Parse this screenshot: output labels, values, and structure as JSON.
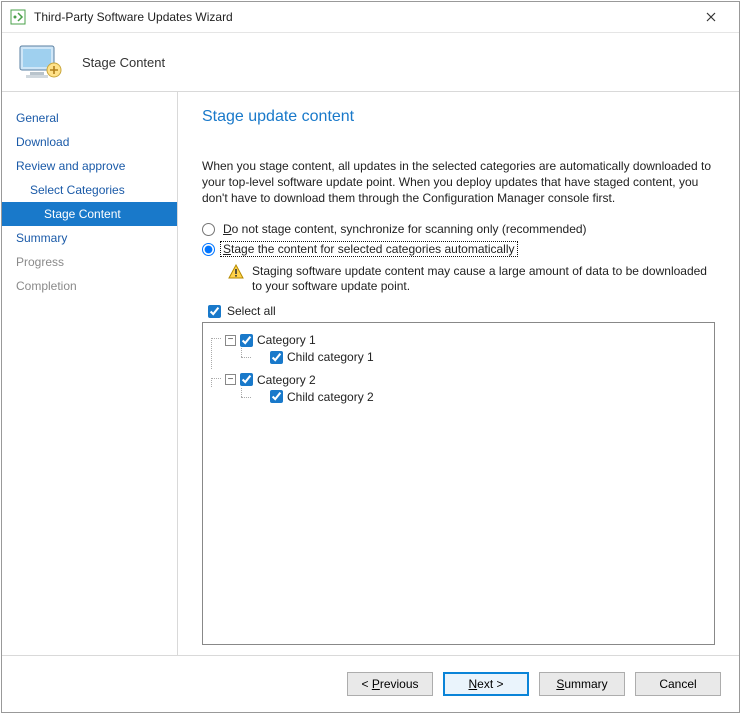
{
  "window": {
    "title": "Third-Party Software Updates Wizard"
  },
  "header": {
    "page_label": "Stage Content"
  },
  "sidebar": {
    "items": [
      {
        "label": "General",
        "level": 0,
        "state": "link"
      },
      {
        "label": "Download",
        "level": 0,
        "state": "link"
      },
      {
        "label": "Review and approve",
        "level": 0,
        "state": "link"
      },
      {
        "label": "Select Categories",
        "level": 1,
        "state": "link"
      },
      {
        "label": "Stage Content",
        "level": 2,
        "state": "active"
      },
      {
        "label": "Summary",
        "level": 0,
        "state": "link"
      },
      {
        "label": "Progress",
        "level": 0,
        "state": "disabled"
      },
      {
        "label": "Completion",
        "level": 0,
        "state": "disabled"
      }
    ]
  },
  "main": {
    "title": "Stage update content",
    "intro": "When you stage content, all updates in the selected categories are automatically downloaded to your top-level software update point. When you deploy updates that have staged content, you don't have to download them through the Configuration Manager console first.",
    "option1_prefix": "D",
    "option1_rest": "o not stage content, synchronize for scanning only (recommended)",
    "option2_prefix": "S",
    "option2_rest": "tage the content for selected categories automatically",
    "selected_option": 2,
    "warning": "Staging software update content may cause a large amount of data to be downloaded to your software update point.",
    "select_all_label": "Select all",
    "select_all_checked": true,
    "tree": [
      {
        "label": "Category 1",
        "checked": true,
        "children": [
          {
            "label": "Child category 1",
            "checked": true
          }
        ]
      },
      {
        "label": "Category 2",
        "checked": true,
        "children": [
          {
            "label": "Child category 2",
            "checked": true
          }
        ]
      }
    ]
  },
  "footer": {
    "previous_u": "P",
    "previous_rest": "revious",
    "next_u": "N",
    "next_rest": "ext >",
    "summary_u": "S",
    "summary_rest": "ummary",
    "cancel": "Cancel"
  }
}
